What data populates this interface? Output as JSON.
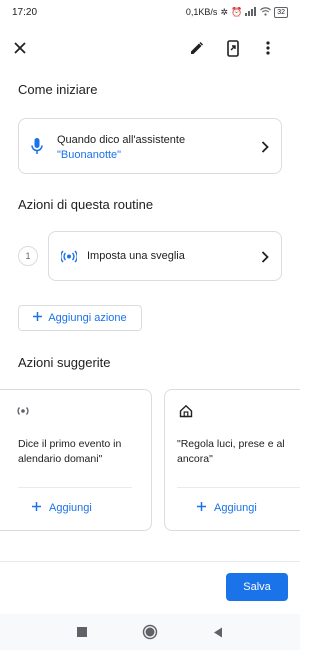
{
  "status_bar": {
    "time": "17:20",
    "network_speed": "0,1KB/s",
    "battery": "32"
  },
  "toolbar": {
    "close_icon": "close-icon",
    "edit_icon": "pencil-icon",
    "shortcut_icon": "phone-shortcut-icon",
    "more_icon": "more-vert-icon"
  },
  "start": {
    "title": "Come iniziare",
    "trigger_label": "Quando dico all'assistente",
    "trigger_phrase": "\"Buonanotte\""
  },
  "actions": {
    "title": "Azioni di questa routine",
    "items": [
      {
        "number": "1",
        "label": "Imposta una sveglia",
        "icon": "alarm-broadcast-icon"
      }
    ],
    "add_label": "Aggiungi azione"
  },
  "suggested": {
    "title": "Azioni suggerite",
    "cards": [
      {
        "icon": "broadcast-icon",
        "line1": "Dice il primo evento in",
        "line2": "alendario domani\"",
        "add_label": "Aggiungi"
      },
      {
        "icon": "home-icon",
        "line1": "\"Regola luci, prese e al",
        "line2": "ancora\"",
        "add_label": "Aggiungi"
      }
    ]
  },
  "footer": {
    "save_label": "Salva"
  },
  "colors": {
    "accent": "#1a73e8",
    "border": "#dadce0",
    "text": "#202124"
  }
}
